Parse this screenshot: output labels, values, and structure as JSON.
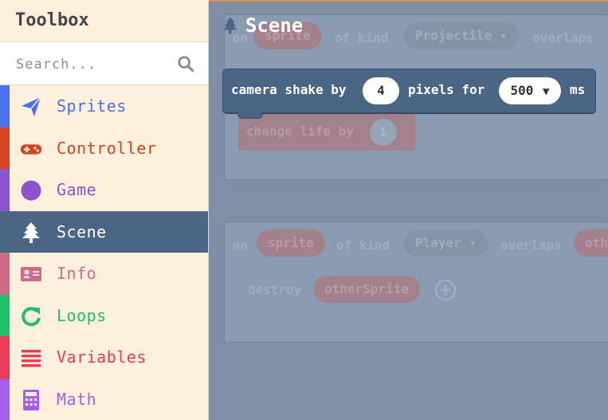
{
  "toolbox": {
    "title": "Toolbox",
    "search": {
      "placeholder": "Search..."
    },
    "categories": [
      {
        "label": "Sprites",
        "color": "#4c6ff0",
        "icon": "paper-plane-icon",
        "selected": false
      },
      {
        "label": "Controller",
        "color": "#d54322",
        "icon": "gamepad-icon",
        "selected": false
      },
      {
        "label": "Game",
        "color": "#8854d0",
        "icon": "circle-icon",
        "selected": false
      },
      {
        "label": "Scene",
        "color": "#4b6584",
        "icon": "tree-icon",
        "selected": true
      },
      {
        "label": "Info",
        "color": "#cf6a87",
        "icon": "id-card-icon",
        "selected": false
      },
      {
        "label": "Loops",
        "color": "#20bf6b",
        "icon": "refresh-icon",
        "selected": false
      },
      {
        "label": "Variables",
        "color": "#ec3a59",
        "icon": "list-icon",
        "selected": false
      },
      {
        "label": "Math",
        "color": "#a55eea",
        "icon": "calculator-icon",
        "selected": false
      }
    ]
  },
  "flyout": {
    "title": "Scene",
    "icon": "tree-icon",
    "camera_block": {
      "w1": "camera shake by",
      "amount": "4",
      "w2": "pixels for",
      "duration": "500",
      "w3": "ms"
    }
  },
  "workspace": {
    "block1": {
      "on": "on",
      "sprite": "sprite",
      "of_kind": "of kind",
      "kind": "Projectile",
      "overlaps": "overlaps",
      "action": "change life by",
      "value": "1"
    },
    "block2": {
      "on": "on",
      "sprite": "sprite",
      "of_kind": "of kind",
      "kind": "Player",
      "overlaps": "overlaps",
      "other": "oth",
      "action": "destroy",
      "target": "otherSprite"
    }
  },
  "colors": {
    "workspace_bg": "#7d8ea5",
    "scene": "#4b6584",
    "toolbox_bg": "#fdf0dd"
  }
}
